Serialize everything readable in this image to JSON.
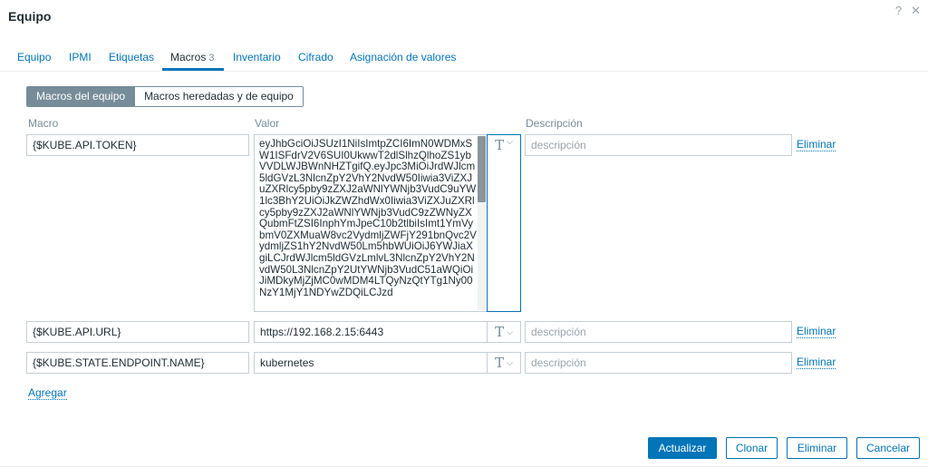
{
  "dialog": {
    "title": "Equipo",
    "help_icon": "?",
    "close_icon": "✕"
  },
  "tabs": [
    {
      "label": "Equipo"
    },
    {
      "label": "IPMI"
    },
    {
      "label": "Etiquetas"
    },
    {
      "label": "Macros",
      "count": "3",
      "active": true
    },
    {
      "label": "Inventario"
    },
    {
      "label": "Cifrado"
    },
    {
      "label": "Asignación de valores"
    }
  ],
  "segments": {
    "host_macros": "Macros del equipo",
    "inherited_macros": "Macros heredadas y de equipo"
  },
  "columns": {
    "macro": "Macro",
    "value": "Valor",
    "description": "Descripción"
  },
  "macros": [
    {
      "macro": "{$KUBE.API.TOKEN}",
      "value": "eyJhbGciOiJSUzI1NiIsImtpZCI6ImN0WDMxSW1ISFdrV2V6SUI0UkwwT2dlSlhzQlhoZS1ybVVDLWJBWnNHZTgifQ.eyJpc3MiOiJrdWJlcm5ldGVzL3NlcnZpY2VhY2NvdW50Iiwia3ViZXJuZXRlcy5pby9zZXJ2aWNlYWNjb3VudC9uYW1lc3BhY2UiOiJkZWZhdWx0Iiwia3ViZXJuZXRlcy5pby9zZXJ2aWNlYWNjb3VudC9zZWNyZXQubmFtZSI6InphYmJpeC10b2tlbiIsImt1YmVybmV0ZXMuaW8vc2VydmljZWFjY291bnQvc2VydmljZS1hY2NvdW50Lm5hbWUiOiJ6YWJiaXgiLCJrdWJlcm5ldGVzLmlvL3NlcnZpY2VhY2NvdW50L3NlcnZpY2UtYWNjb3VudC51aWQiOiJiMDkyMjZjMC0wMDM4LTQyNzQtYTg1Ny00NzY1MjY1NDYwZDQiLCJzd",
      "description_placeholder": "descripción",
      "remove": "Eliminar"
    },
    {
      "macro": "{$KUBE.API.URL}",
      "value": "https://192.168.2.15:6443",
      "description_placeholder": "descripción",
      "remove": "Eliminar"
    },
    {
      "macro": "{$KUBE.STATE.ENDPOINT.NAME}",
      "value": "kubernetes",
      "description_placeholder": "descripción",
      "remove": "Eliminar"
    }
  ],
  "type_icon": "T",
  "add_link": "Agregar",
  "buttons": {
    "update": "Actualizar",
    "clone": "Clonar",
    "delete": "Eliminar",
    "cancel": "Cancelar"
  },
  "colors": {
    "accent": "#0275b8",
    "segment_active": "#768d99"
  }
}
